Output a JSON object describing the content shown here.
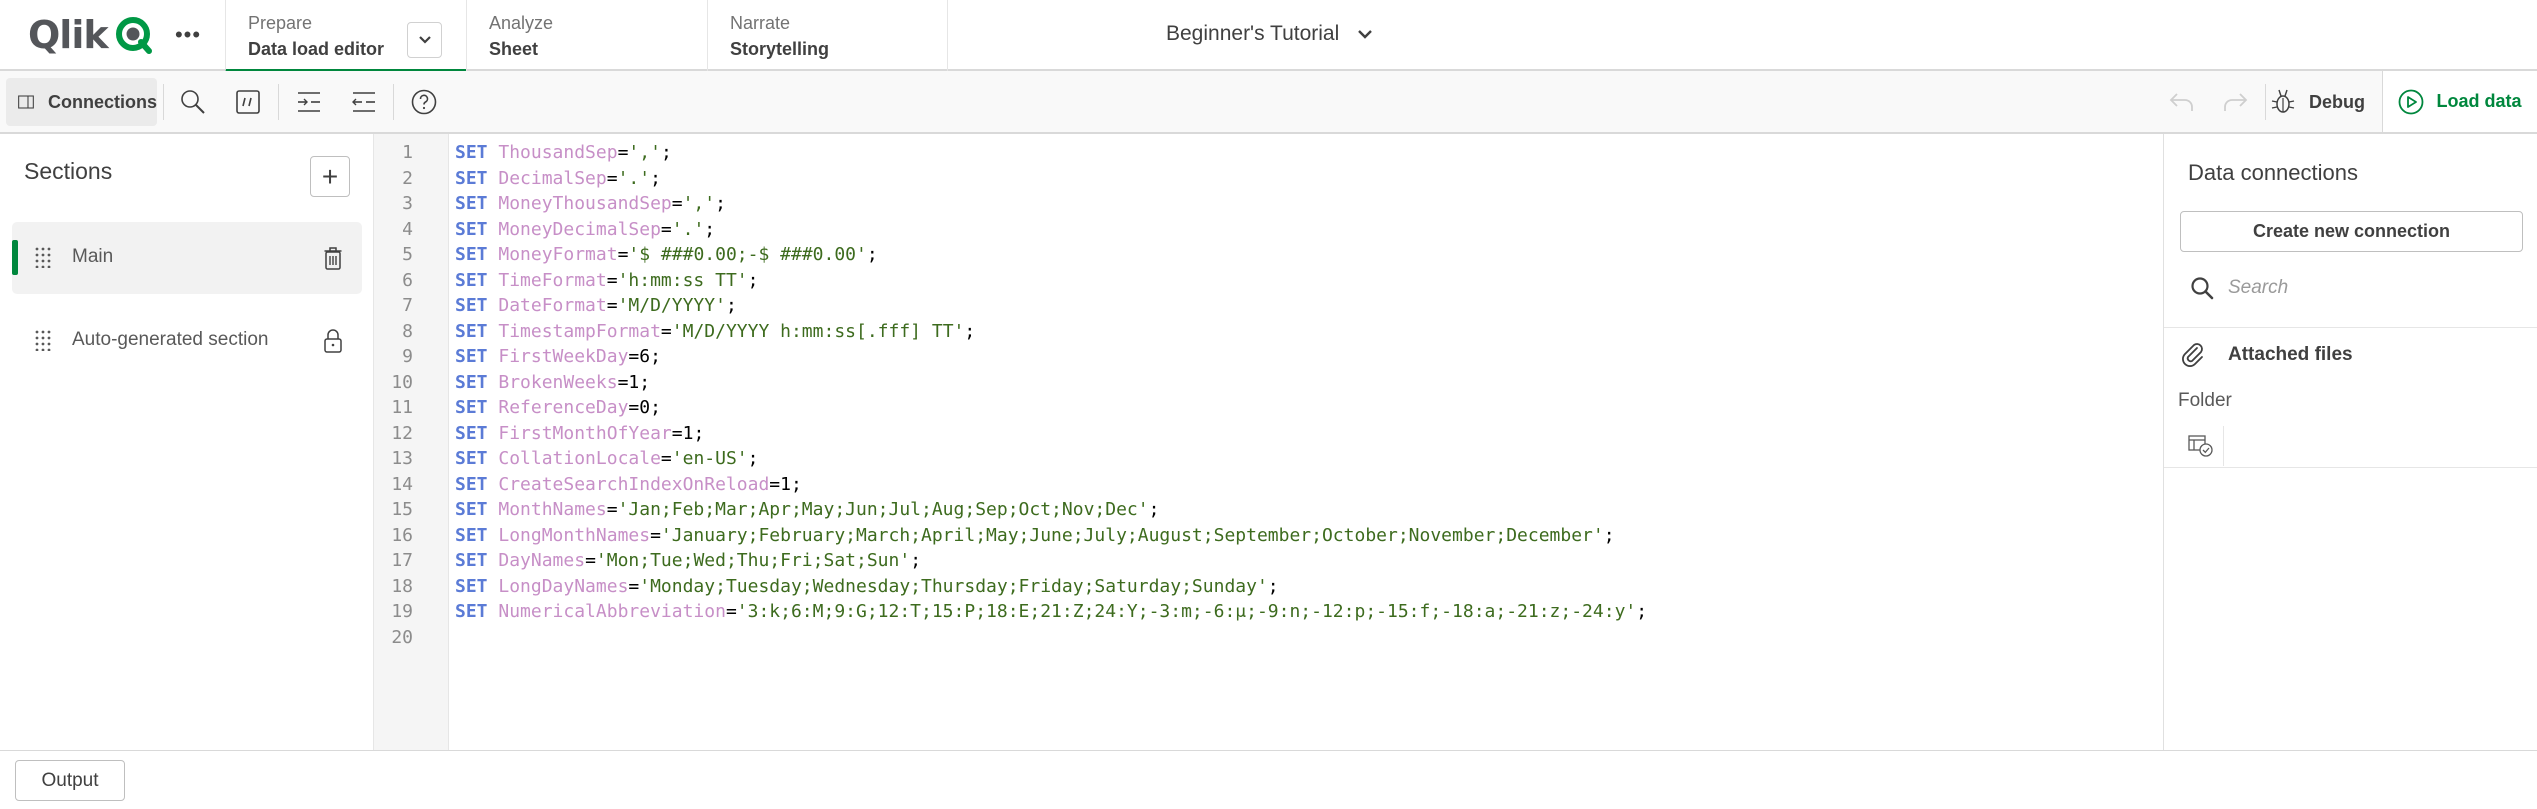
{
  "header": {
    "logo_text": "Qlik",
    "more_label": "•••",
    "nav_tabs": [
      {
        "kicker": "Prepare",
        "label": "Data load editor",
        "active": true
      },
      {
        "kicker": "Analyze",
        "label": "Sheet",
        "active": false
      },
      {
        "kicker": "Narrate",
        "label": "Storytelling",
        "active": false
      }
    ],
    "app_title": "Beginner's Tutorial"
  },
  "toolbar": {
    "connections_label": "Connections",
    "debug_label": "Debug",
    "load_data_label": "Load data",
    "icons": [
      "panel-toggle-icon",
      "search-icon",
      "comment-icon",
      "indent-icon",
      "outdent-icon",
      "help-icon",
      "undo-icon",
      "redo-icon",
      "bug-icon",
      "play-icon"
    ]
  },
  "sections": {
    "title": "Sections",
    "add_label": "+",
    "items": [
      {
        "name": "Main",
        "active": true,
        "action_icon": "trash-icon"
      },
      {
        "name": "Auto-generated section",
        "active": false,
        "action_icon": "lock-icon"
      }
    ]
  },
  "editor": {
    "lines": [
      {
        "n": "1",
        "kw": "SET",
        "id": "ThousandSep",
        "eq": "=",
        "val": "','",
        "val_type": "str",
        "end": ";"
      },
      {
        "n": "2",
        "kw": "SET",
        "id": "DecimalSep",
        "eq": "=",
        "val": "'.'",
        "val_type": "str",
        "end": ";"
      },
      {
        "n": "3",
        "kw": "SET",
        "id": "MoneyThousandSep",
        "eq": "=",
        "val": "','",
        "val_type": "str",
        "end": ";"
      },
      {
        "n": "4",
        "kw": "SET",
        "id": "MoneyDecimalSep",
        "eq": "=",
        "val": "'.'",
        "val_type": "str",
        "end": ";"
      },
      {
        "n": "5",
        "kw": "SET",
        "id": "MoneyFormat",
        "eq": "=",
        "val": "'$ ###0.00;-$ ###0.00'",
        "val_type": "str",
        "end": ";"
      },
      {
        "n": "6",
        "kw": "SET",
        "id": "TimeFormat",
        "eq": "=",
        "val": "'h:mm:ss TT'",
        "val_type": "str",
        "end": ";"
      },
      {
        "n": "7",
        "kw": "SET",
        "id": "DateFormat",
        "eq": "=",
        "val": "'M/D/YYYY'",
        "val_type": "str",
        "end": ";"
      },
      {
        "n": "8",
        "kw": "SET",
        "id": "TimestampFormat",
        "eq": "=",
        "val": "'M/D/YYYY h:mm:ss[.fff] TT'",
        "val_type": "str",
        "end": ";"
      },
      {
        "n": "9",
        "kw": "SET",
        "id": "FirstWeekDay",
        "eq": "=",
        "val": "6",
        "val_type": "num",
        "end": ";"
      },
      {
        "n": "10",
        "kw": "SET",
        "id": "BrokenWeeks",
        "eq": "=",
        "val": "1",
        "val_type": "num",
        "end": ";"
      },
      {
        "n": "11",
        "kw": "SET",
        "id": "ReferenceDay",
        "eq": "=",
        "val": "0",
        "val_type": "num",
        "end": ";"
      },
      {
        "n": "12",
        "kw": "SET",
        "id": "FirstMonthOfYear",
        "eq": "=",
        "val": "1",
        "val_type": "num",
        "end": ";"
      },
      {
        "n": "13",
        "kw": "SET",
        "id": "CollationLocale",
        "eq": "=",
        "val": "'en-US'",
        "val_type": "str",
        "end": ";"
      },
      {
        "n": "14",
        "kw": "SET",
        "id": "CreateSearchIndexOnReload",
        "eq": "=",
        "val": "1",
        "val_type": "num",
        "end": ";"
      },
      {
        "n": "15",
        "kw": "SET",
        "id": "MonthNames",
        "eq": "=",
        "val": "'Jan;Feb;Mar;Apr;May;Jun;Jul;Aug;Sep;Oct;Nov;Dec'",
        "val_type": "str",
        "end": ";"
      },
      {
        "n": "16",
        "kw": "SET",
        "id": "LongMonthNames",
        "eq": "=",
        "val": "'January;February;March;April;May;June;July;August;September;October;November;December'",
        "val_type": "str",
        "end": ";"
      },
      {
        "n": "17",
        "kw": "SET",
        "id": "DayNames",
        "eq": "=",
        "val": "'Mon;Tue;Wed;Thu;Fri;Sat;Sun'",
        "val_type": "str",
        "end": ";"
      },
      {
        "n": "18",
        "kw": "SET",
        "id": "LongDayNames",
        "eq": "=",
        "val": "'Monday;Tuesday;Wednesday;Thursday;Friday;Saturday;Sunday'",
        "val_type": "str",
        "end": ";"
      },
      {
        "n": "19",
        "kw": "SET",
        "id": "NumericalAbbreviation",
        "eq": "=",
        "val": "'3:k;6:M;9:G;12:T;15:P;18:E;21:Z;24:Y;-3:m;-6:μ;-9:n;-12:p;-15:f;-18:a;-21:z;-24:y'",
        "val_type": "str",
        "end": ";"
      },
      {
        "n": "20",
        "kw": "",
        "id": "",
        "eq": "",
        "val": "",
        "val_type": "",
        "end": ""
      }
    ]
  },
  "right_panel": {
    "title": "Data connections",
    "create_label": "Create new connection",
    "search_placeholder": "Search",
    "attached_label": "Attached files",
    "folder_label": "Folder"
  },
  "bottom": {
    "output_label": "Output"
  },
  "colors": {
    "accent_green": "#00873d",
    "logo_green": "#009845",
    "keyword": "#5b7bd6",
    "identifier": "#c78fc7",
    "string": "#3d6b1e"
  }
}
